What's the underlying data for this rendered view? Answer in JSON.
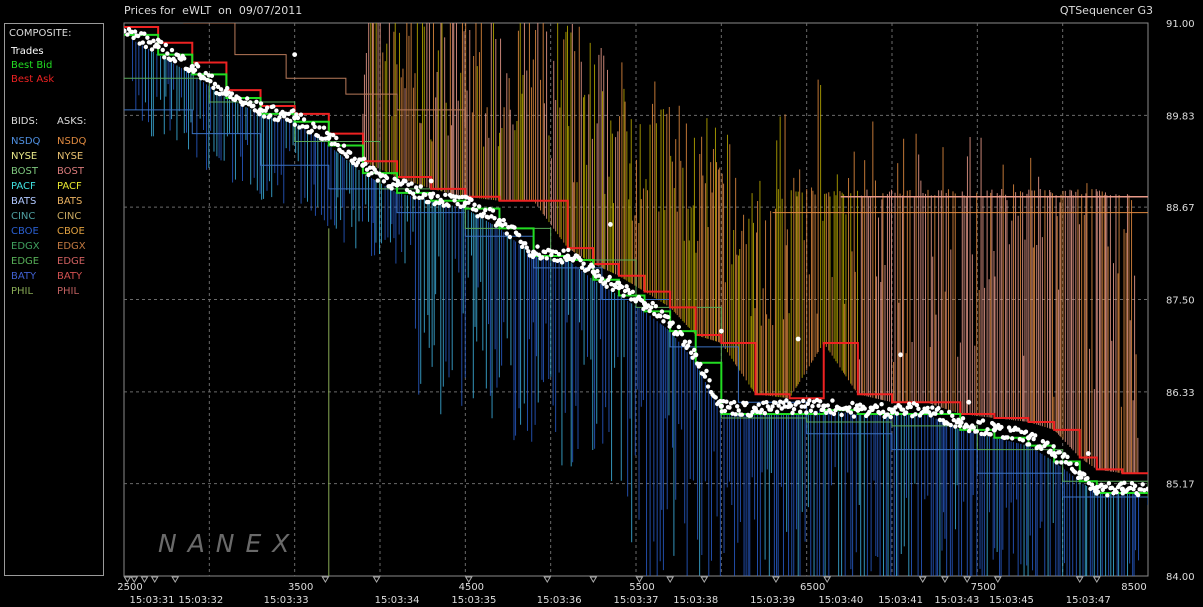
{
  "header": {
    "title": "Prices for  eWLT  on  09/07/2011",
    "right_label": "QTSequencer G3"
  },
  "legend": {
    "composite_heading": "COMPOSITE:",
    "composite": [
      {
        "label": "Trades",
        "color": "#ffffff"
      },
      {
        "label": "Best Bid",
        "color": "#22dd22"
      },
      {
        "label": "Best Ask",
        "color": "#ee2222"
      }
    ],
    "bids_heading": "BIDS:",
    "asks_heading": "ASKS:",
    "exchanges": [
      {
        "bid": "NSDQ",
        "bid_color": "#4f8fe0",
        "ask": "NSDQ",
        "ask_color": "#e08a40"
      },
      {
        "bid": "NYSE",
        "bid_color": "#e8e88a",
        "ask": "NYSE",
        "ask_color": "#e8c070"
      },
      {
        "bid": "BOST",
        "bid_color": "#7ec77e",
        "ask": "BOST",
        "ask_color": "#d87a7a"
      },
      {
        "bid": "PACF",
        "bid_color": "#40e0e0",
        "ask": "PACF",
        "ask_color": "#e8e830"
      },
      {
        "bid": "BATS",
        "bid_color": "#b0c8ff",
        "ask": "BATS",
        "ask_color": "#e8b060"
      },
      {
        "bid": "CINC",
        "bid_color": "#4f9fa0",
        "ask": "CINC",
        "ask_color": "#c8a860"
      },
      {
        "bid": "CBOE",
        "bid_color": "#2a5fd0",
        "ask": "CBOE",
        "ask_color": "#e0a040"
      },
      {
        "bid": "EDGX",
        "bid_color": "#3fa05f",
        "ask": "EDGX",
        "ask_color": "#c07840"
      },
      {
        "bid": "EDGE",
        "bid_color": "#58b058",
        "ask": "EDGE",
        "ask_color": "#d06060"
      },
      {
        "bid": "BATY",
        "bid_color": "#4060d0",
        "ask": "BATY",
        "ask_color": "#d05050"
      },
      {
        "bid": "PHIL",
        "bid_color": "#88aa55",
        "ask": "PHIL",
        "ask_color": "#c06060"
      }
    ]
  },
  "watermark": "NANEX",
  "colors": {
    "trade": "#ffffff",
    "best_bid": "#22dd22",
    "best_ask": "#ee2222",
    "bid_blue": "#2a5fd0",
    "bid_light": "#40b8e8",
    "ask_orange": "#e08a40",
    "ask_salmon": "#e89a8a",
    "ask_olive": "#b8a800",
    "grid": "#6a6a6a"
  },
  "chart_data": {
    "type": "line",
    "title": "Prices for  eWLT  on  09/07/2011",
    "xlabel": "",
    "ylabel": "",
    "x_range": [
      2500,
      8500
    ],
    "y_range": [
      84.0,
      91.0
    ],
    "y_ticks": [
      91.0,
      89.83,
      88.67,
      87.5,
      86.33,
      85.17,
      84.0
    ],
    "y_tick_labels": [
      "91.00",
      "89.83",
      "88.67",
      "87.50",
      "86.33",
      "85.17",
      "84.00"
    ],
    "x_ticks": [
      2500,
      3500,
      4500,
      5500,
      6500,
      7500,
      8500
    ],
    "x_tick_labels": [
      "2500",
      "3500",
      "4500",
      "5500",
      "6500",
      "7500",
      "8500"
    ],
    "time_labels": [
      {
        "seq": 2500,
        "label": "15:03:31"
      },
      {
        "seq": 2950,
        "label": "15:03:32"
      },
      {
        "seq": 3450,
        "label": "15:03:33"
      },
      {
        "seq": 4100,
        "label": "15:03:34"
      },
      {
        "seq": 4550,
        "label": "15:03:35"
      },
      {
        "seq": 5050,
        "label": "15:03:36"
      },
      {
        "seq": 5500,
        "label": "15:03:37"
      },
      {
        "seq": 5850,
        "label": "15:03:38"
      },
      {
        "seq": 6300,
        "label": "15:03:39"
      },
      {
        "seq": 6700,
        "label": "15:03:40"
      },
      {
        "seq": 7050,
        "label": "15:03:41"
      },
      {
        "seq": 7380,
        "label": "15:03:43"
      },
      {
        "seq": 7700,
        "label": "15:03:45"
      },
      {
        "seq": 8150,
        "label": "15:03:47"
      }
    ],
    "grid": true,
    "legend_position": "left",
    "series": [
      {
        "name": "Trades",
        "color": "#ffffff",
        "points": [
          [
            2500,
            90.9
          ],
          [
            2700,
            90.7
          ],
          [
            2900,
            90.45
          ],
          [
            3100,
            90.1
          ],
          [
            3300,
            89.9
          ],
          [
            3500,
            89.8
          ],
          [
            3700,
            89.55
          ],
          [
            3900,
            89.2
          ],
          [
            4100,
            88.95
          ],
          [
            4300,
            88.8
          ],
          [
            4500,
            88.72
          ],
          [
            4700,
            88.5
          ],
          [
            4900,
            88.1
          ],
          [
            5100,
            88.05
          ],
          [
            5250,
            87.85
          ],
          [
            5400,
            87.65
          ],
          [
            5550,
            87.45
          ],
          [
            5700,
            87.2
          ],
          [
            5850,
            86.8
          ],
          [
            6000,
            86.15
          ],
          [
            6200,
            86.1
          ],
          [
            6400,
            86.15
          ],
          [
            6600,
            86.15
          ],
          [
            6800,
            86.1
          ],
          [
            7000,
            86.1
          ],
          [
            7200,
            86.1
          ],
          [
            7400,
            85.95
          ],
          [
            7600,
            85.85
          ],
          [
            7800,
            85.75
          ],
          [
            7950,
            85.55
          ],
          [
            8100,
            85.3
          ],
          [
            8200,
            85.12
          ],
          [
            8350,
            85.1
          ],
          [
            8500,
            85.1
          ]
        ]
      },
      {
        "name": "Best Bid",
        "color": "#22dd22",
        "points": [
          [
            2500,
            90.85
          ],
          [
            2700,
            90.6
          ],
          [
            2900,
            90.35
          ],
          [
            3100,
            90.05
          ],
          [
            3300,
            89.85
          ],
          [
            3500,
            89.75
          ],
          [
            3700,
            89.45
          ],
          [
            3900,
            89.1
          ],
          [
            4100,
            88.85
          ],
          [
            4300,
            88.75
          ],
          [
            4500,
            88.65
          ],
          [
            4700,
            88.4
          ],
          [
            4900,
            88.05
          ],
          [
            5100,
            88.0
          ],
          [
            5250,
            87.75
          ],
          [
            5400,
            87.55
          ],
          [
            5550,
            87.35
          ],
          [
            5700,
            87.1
          ],
          [
            5850,
            86.7
          ],
          [
            6000,
            86.05
          ],
          [
            6200,
            86.05
          ],
          [
            6400,
            86.05
          ],
          [
            6600,
            86.1
          ],
          [
            6800,
            86.05
          ],
          [
            7000,
            86.05
          ],
          [
            7200,
            86.05
          ],
          [
            7400,
            85.85
          ],
          [
            7600,
            85.75
          ],
          [
            7800,
            85.65
          ],
          [
            7950,
            85.45
          ],
          [
            8100,
            85.2
          ],
          [
            8200,
            85.05
          ],
          [
            8350,
            85.05
          ],
          [
            8500,
            85.05
          ]
        ]
      },
      {
        "name": "Best Ask",
        "color": "#ee2222",
        "points": [
          [
            2500,
            90.95
          ],
          [
            2700,
            90.75
          ],
          [
            2900,
            90.5
          ],
          [
            3100,
            90.15
          ],
          [
            3300,
            89.95
          ],
          [
            3500,
            89.85
          ],
          [
            3700,
            89.6
          ],
          [
            3900,
            89.25
          ],
          [
            4100,
            89.05
          ],
          [
            4300,
            88.9
          ],
          [
            4500,
            88.8
          ],
          [
            4700,
            88.75
          ],
          [
            4900,
            88.75
          ],
          [
            5100,
            88.15
          ],
          [
            5250,
            87.95
          ],
          [
            5400,
            87.8
          ],
          [
            5550,
            87.6
          ],
          [
            5700,
            87.4
          ],
          [
            5850,
            87.05
          ],
          [
            6000,
            86.95
          ],
          [
            6200,
            86.3
          ],
          [
            6400,
            86.25
          ],
          [
            6600,
            86.95
          ],
          [
            6800,
            86.3
          ],
          [
            7000,
            86.2
          ],
          [
            7200,
            86.2
          ],
          [
            7400,
            86.05
          ],
          [
            7600,
            86.0
          ],
          [
            7800,
            85.95
          ],
          [
            7950,
            85.85
          ],
          [
            8100,
            85.5
          ],
          [
            8200,
            85.35
          ],
          [
            8350,
            85.3
          ],
          [
            8500,
            85.3
          ]
        ]
      }
    ]
  }
}
